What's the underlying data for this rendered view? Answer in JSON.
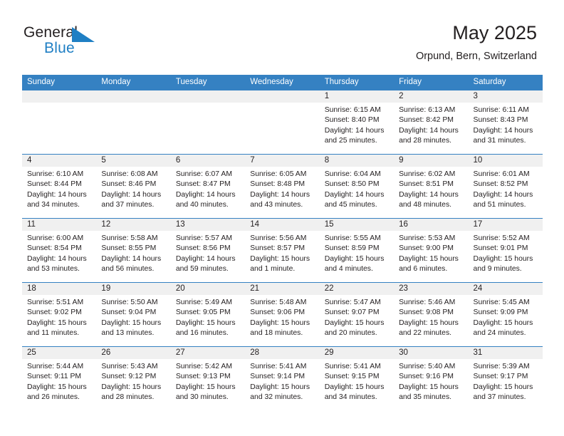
{
  "brand": {
    "word_one": "General",
    "word_two": "Blue",
    "triangle_color": "#1f7fc4"
  },
  "header": {
    "title": "May 2025",
    "subtitle": "Orpund, Bern, Switzerland",
    "accent_color": "#3581c2",
    "daynum_band_color": "#f0f0f0"
  },
  "weekdays": [
    "Sunday",
    "Monday",
    "Tuesday",
    "Wednesday",
    "Thursday",
    "Friday",
    "Saturday"
  ],
  "labels": {
    "sunrise_prefix": "Sunrise: ",
    "sunset_prefix": "Sunset: ",
    "daylight_prefix": "Daylight: "
  },
  "weeks": [
    [
      {
        "day": ""
      },
      {
        "day": ""
      },
      {
        "day": ""
      },
      {
        "day": ""
      },
      {
        "day": "1",
        "sunrise": "Sunrise: 6:15 AM",
        "sunset": "Sunset: 8:40 PM",
        "daylight_line1": "Daylight: 14 hours",
        "daylight_line2": "and 25 minutes."
      },
      {
        "day": "2",
        "sunrise": "Sunrise: 6:13 AM",
        "sunset": "Sunset: 8:42 PM",
        "daylight_line1": "Daylight: 14 hours",
        "daylight_line2": "and 28 minutes."
      },
      {
        "day": "3",
        "sunrise": "Sunrise: 6:11 AM",
        "sunset": "Sunset: 8:43 PM",
        "daylight_line1": "Daylight: 14 hours",
        "daylight_line2": "and 31 minutes."
      }
    ],
    [
      {
        "day": "4",
        "sunrise": "Sunrise: 6:10 AM",
        "sunset": "Sunset: 8:44 PM",
        "daylight_line1": "Daylight: 14 hours",
        "daylight_line2": "and 34 minutes."
      },
      {
        "day": "5",
        "sunrise": "Sunrise: 6:08 AM",
        "sunset": "Sunset: 8:46 PM",
        "daylight_line1": "Daylight: 14 hours",
        "daylight_line2": "and 37 minutes."
      },
      {
        "day": "6",
        "sunrise": "Sunrise: 6:07 AM",
        "sunset": "Sunset: 8:47 PM",
        "daylight_line1": "Daylight: 14 hours",
        "daylight_line2": "and 40 minutes."
      },
      {
        "day": "7",
        "sunrise": "Sunrise: 6:05 AM",
        "sunset": "Sunset: 8:48 PM",
        "daylight_line1": "Daylight: 14 hours",
        "daylight_line2": "and 43 minutes."
      },
      {
        "day": "8",
        "sunrise": "Sunrise: 6:04 AM",
        "sunset": "Sunset: 8:50 PM",
        "daylight_line1": "Daylight: 14 hours",
        "daylight_line2": "and 45 minutes."
      },
      {
        "day": "9",
        "sunrise": "Sunrise: 6:02 AM",
        "sunset": "Sunset: 8:51 PM",
        "daylight_line1": "Daylight: 14 hours",
        "daylight_line2": "and 48 minutes."
      },
      {
        "day": "10",
        "sunrise": "Sunrise: 6:01 AM",
        "sunset": "Sunset: 8:52 PM",
        "daylight_line1": "Daylight: 14 hours",
        "daylight_line2": "and 51 minutes."
      }
    ],
    [
      {
        "day": "11",
        "sunrise": "Sunrise: 6:00 AM",
        "sunset": "Sunset: 8:54 PM",
        "daylight_line1": "Daylight: 14 hours",
        "daylight_line2": "and 53 minutes."
      },
      {
        "day": "12",
        "sunrise": "Sunrise: 5:58 AM",
        "sunset": "Sunset: 8:55 PM",
        "daylight_line1": "Daylight: 14 hours",
        "daylight_line2": "and 56 minutes."
      },
      {
        "day": "13",
        "sunrise": "Sunrise: 5:57 AM",
        "sunset": "Sunset: 8:56 PM",
        "daylight_line1": "Daylight: 14 hours",
        "daylight_line2": "and 59 minutes."
      },
      {
        "day": "14",
        "sunrise": "Sunrise: 5:56 AM",
        "sunset": "Sunset: 8:57 PM",
        "daylight_line1": "Daylight: 15 hours",
        "daylight_line2": "and 1 minute."
      },
      {
        "day": "15",
        "sunrise": "Sunrise: 5:55 AM",
        "sunset": "Sunset: 8:59 PM",
        "daylight_line1": "Daylight: 15 hours",
        "daylight_line2": "and 4 minutes."
      },
      {
        "day": "16",
        "sunrise": "Sunrise: 5:53 AM",
        "sunset": "Sunset: 9:00 PM",
        "daylight_line1": "Daylight: 15 hours",
        "daylight_line2": "and 6 minutes."
      },
      {
        "day": "17",
        "sunrise": "Sunrise: 5:52 AM",
        "sunset": "Sunset: 9:01 PM",
        "daylight_line1": "Daylight: 15 hours",
        "daylight_line2": "and 9 minutes."
      }
    ],
    [
      {
        "day": "18",
        "sunrise": "Sunrise: 5:51 AM",
        "sunset": "Sunset: 9:02 PM",
        "daylight_line1": "Daylight: 15 hours",
        "daylight_line2": "and 11 minutes."
      },
      {
        "day": "19",
        "sunrise": "Sunrise: 5:50 AM",
        "sunset": "Sunset: 9:04 PM",
        "daylight_line1": "Daylight: 15 hours",
        "daylight_line2": "and 13 minutes."
      },
      {
        "day": "20",
        "sunrise": "Sunrise: 5:49 AM",
        "sunset": "Sunset: 9:05 PM",
        "daylight_line1": "Daylight: 15 hours",
        "daylight_line2": "and 16 minutes."
      },
      {
        "day": "21",
        "sunrise": "Sunrise: 5:48 AM",
        "sunset": "Sunset: 9:06 PM",
        "daylight_line1": "Daylight: 15 hours",
        "daylight_line2": "and 18 minutes."
      },
      {
        "day": "22",
        "sunrise": "Sunrise: 5:47 AM",
        "sunset": "Sunset: 9:07 PM",
        "daylight_line1": "Daylight: 15 hours",
        "daylight_line2": "and 20 minutes."
      },
      {
        "day": "23",
        "sunrise": "Sunrise: 5:46 AM",
        "sunset": "Sunset: 9:08 PM",
        "daylight_line1": "Daylight: 15 hours",
        "daylight_line2": "and 22 minutes."
      },
      {
        "day": "24",
        "sunrise": "Sunrise: 5:45 AM",
        "sunset": "Sunset: 9:09 PM",
        "daylight_line1": "Daylight: 15 hours",
        "daylight_line2": "and 24 minutes."
      }
    ],
    [
      {
        "day": "25",
        "sunrise": "Sunrise: 5:44 AM",
        "sunset": "Sunset: 9:11 PM",
        "daylight_line1": "Daylight: 15 hours",
        "daylight_line2": "and 26 minutes."
      },
      {
        "day": "26",
        "sunrise": "Sunrise: 5:43 AM",
        "sunset": "Sunset: 9:12 PM",
        "daylight_line1": "Daylight: 15 hours",
        "daylight_line2": "and 28 minutes."
      },
      {
        "day": "27",
        "sunrise": "Sunrise: 5:42 AM",
        "sunset": "Sunset: 9:13 PM",
        "daylight_line1": "Daylight: 15 hours",
        "daylight_line2": "and 30 minutes."
      },
      {
        "day": "28",
        "sunrise": "Sunrise: 5:41 AM",
        "sunset": "Sunset: 9:14 PM",
        "daylight_line1": "Daylight: 15 hours",
        "daylight_line2": "and 32 minutes."
      },
      {
        "day": "29",
        "sunrise": "Sunrise: 5:41 AM",
        "sunset": "Sunset: 9:15 PM",
        "daylight_line1": "Daylight: 15 hours",
        "daylight_line2": "and 34 minutes."
      },
      {
        "day": "30",
        "sunrise": "Sunrise: 5:40 AM",
        "sunset": "Sunset: 9:16 PM",
        "daylight_line1": "Daylight: 15 hours",
        "daylight_line2": "and 35 minutes."
      },
      {
        "day": "31",
        "sunrise": "Sunrise: 5:39 AM",
        "sunset": "Sunset: 9:17 PM",
        "daylight_line1": "Daylight: 15 hours",
        "daylight_line2": "and 37 minutes."
      }
    ]
  ]
}
